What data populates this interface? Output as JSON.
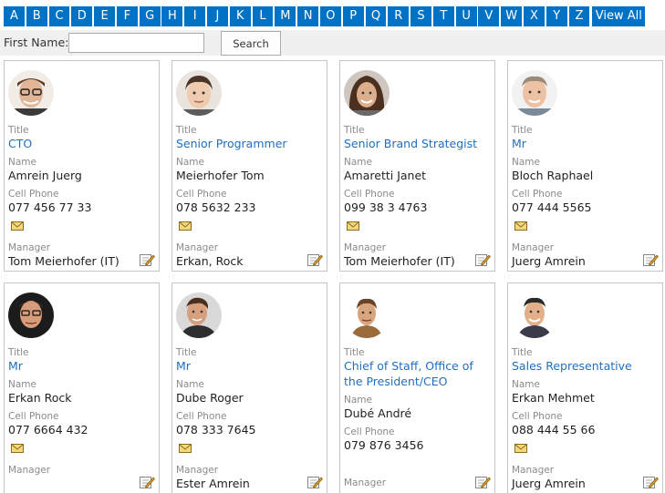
{
  "alphabet": [
    "A",
    "B",
    "C",
    "D",
    "E",
    "F",
    "G",
    "H",
    "I",
    "J",
    "K",
    "L",
    "M",
    "N",
    "O",
    "P",
    "Q",
    "R",
    "S",
    "T",
    "U",
    "V",
    "W",
    "X",
    "Y",
    "Z"
  ],
  "view_all_label": "View All",
  "search": {
    "label": "First Name:",
    "value": "",
    "button_label": "Search"
  },
  "field_labels": {
    "title": "Title",
    "name": "Name",
    "cell": "Cell Phone",
    "manager": "Manager"
  },
  "cards": [
    {
      "title": "CTO",
      "name": "Amrein Juerg",
      "cell": "077 456 77 33",
      "manager": "Tom Meierhofer (IT)"
    },
    {
      "title": "Senior Programmer",
      "name": "Meierhofer Tom",
      "cell": "078 5632 233",
      "manager": "Erkan, Rock"
    },
    {
      "title": "Senior Brand Strategist",
      "name": "Amaretti Janet",
      "cell": "099 38 3 4763",
      "manager": "Tom Meierhofer (IT)"
    },
    {
      "title": "Mr",
      "name": "Bloch Raphael",
      "cell": "077 444 5565",
      "manager": "Juerg Amrein"
    },
    {
      "title": "Mr",
      "name": "Erkan Rock",
      "cell": "077 6664 432",
      "manager": ""
    },
    {
      "title": "Mr",
      "name": "Dube Roger",
      "cell": "078 333 7645",
      "manager": "Ester Amrein"
    },
    {
      "title": "Chief of Staff, Office of the President/CEO",
      "name": "Dubé André",
      "cell": "079 876 3456",
      "manager": ""
    },
    {
      "title": "Sales Representative",
      "name": "Erkan Mehmet",
      "cell": "088 444 55 66",
      "manager": "Juerg Amrein"
    }
  ],
  "colors": {
    "accent": "#0072c6",
    "title_link": "#1f6fbf",
    "label": "#8a8a8a"
  }
}
